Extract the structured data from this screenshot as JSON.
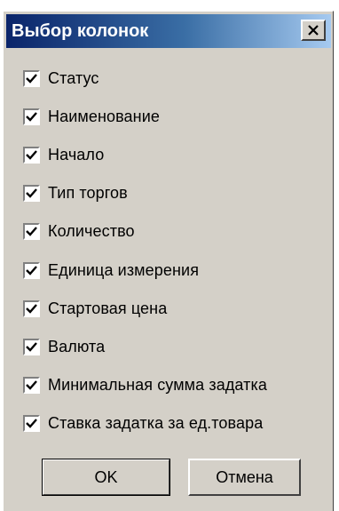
{
  "window": {
    "title": "Выбор колонок"
  },
  "titlebar": {
    "close_icon": "close-icon"
  },
  "columns": [
    {
      "label": "Статус",
      "checked": true
    },
    {
      "label": "Наименование",
      "checked": true
    },
    {
      "label": "Начало",
      "checked": true
    },
    {
      "label": "Тип торгов",
      "checked": true
    },
    {
      "label": "Количество",
      "checked": true
    },
    {
      "label": "Единица измерения",
      "checked": true
    },
    {
      "label": "Стартовая цена",
      "checked": true
    },
    {
      "label": "Валюта",
      "checked": true
    },
    {
      "label": "Минимальная сумма задатка",
      "checked": true
    },
    {
      "label": "Ставка задатка за ед.товара",
      "checked": true
    }
  ],
  "buttons": {
    "ok_label": "OK",
    "cancel_label": "Отмена"
  },
  "colors": {
    "face": "#d4d0c8",
    "titlebar_start": "#0a246a",
    "titlebar_end": "#a6caf0"
  }
}
